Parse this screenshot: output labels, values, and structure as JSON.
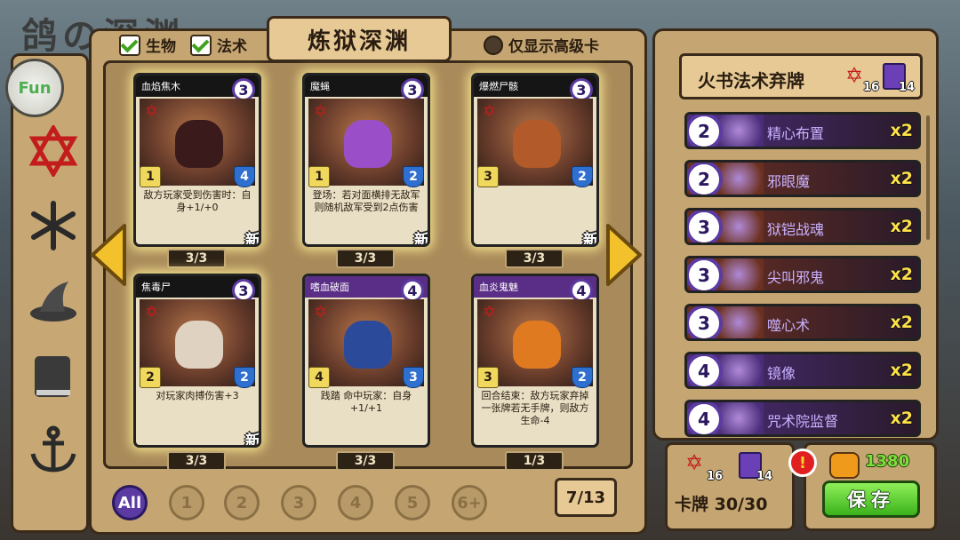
{
  "background": {
    "title": "鸽の深渊"
  },
  "logo": {
    "text": "Fun"
  },
  "filters": {
    "creature_label": "生物",
    "spell_label": "法术",
    "advanced_only_label": "仅显示高级卡"
  },
  "collection": {
    "title": "炼狱深渊",
    "cards": [
      {
        "name": "血焰焦木",
        "cost": "3",
        "attack": "1",
        "health": "4",
        "desc": "敌方玩家受到伤害时：自身+1/+0",
        "new": "新",
        "count": "3/3",
        "rarity": "common",
        "art_color": "#3a1a1a"
      },
      {
        "name": "魔蝇",
        "cost": "3",
        "attack": "1",
        "health": "2",
        "desc": "登场：若对面横排无敌军则随机敌军受到2点伤害",
        "new": "新",
        "count": "3/3",
        "rarity": "common",
        "art_color": "#9a4fc8"
      },
      {
        "name": "爆燃尸骸",
        "cost": "3",
        "attack": "3",
        "health": "2",
        "desc": "",
        "new": "新",
        "count": "3/3",
        "rarity": "common",
        "art_color": "#b25a2a"
      },
      {
        "name": "焦毒尸",
        "cost": "3",
        "attack": "2",
        "health": "2",
        "desc": "对玩家肉搏伤害+3",
        "new": "新",
        "count": "3/3",
        "rarity": "common",
        "art_color": "#e0d2c0"
      },
      {
        "name": "嗜血破面",
        "cost": "4",
        "attack": "4",
        "health": "3",
        "desc": "践踏 命中玩家：自身+1/+1",
        "new": "",
        "count": "3/3",
        "rarity": "epic",
        "art_color": "#2c4a9a"
      },
      {
        "name": "血炎鬼魅",
        "cost": "4",
        "attack": "3",
        "health": "2",
        "desc": "回合结束：敌方玩家弃掉一张牌若无手牌，则敌方生命-4",
        "new": "",
        "count": "1/3",
        "rarity": "epic",
        "art_color": "#e07a20"
      }
    ]
  },
  "pagination": {
    "buttons": [
      "All",
      "1",
      "2",
      "3",
      "4",
      "5",
      "6+"
    ],
    "active": "All",
    "page_count": "7/13"
  },
  "deck": {
    "name": "火书法术弃牌",
    "hex_count": "16",
    "book_count": "14",
    "entries": [
      {
        "cost": "2",
        "name": "精心布置",
        "mult": "x2",
        "color": "#4a2d7a"
      },
      {
        "cost": "2",
        "name": "邪眼魔",
        "mult": "x2",
        "color": "#6b3020"
      },
      {
        "cost": "3",
        "name": "狱铠战魂",
        "mult": "x2",
        "color": "#6b3020"
      },
      {
        "cost": "3",
        "name": "尖叫邪鬼",
        "mult": "x2",
        "color": "#6b3020"
      },
      {
        "cost": "3",
        "name": "噬心术",
        "mult": "x2",
        "color": "#6b3020"
      },
      {
        "cost": "4",
        "name": "镜像",
        "mult": "x2",
        "color": "#4a2d7a"
      },
      {
        "cost": "4",
        "name": "咒术院监督",
        "mult": "x2",
        "color": "#4a2d7a"
      }
    ]
  },
  "deck_stats": {
    "hex_count": "16",
    "book_count": "14",
    "card_total": "卡牌 30/30"
  },
  "resources": {
    "gold": "1380",
    "warning": "!"
  },
  "save_button": "保存",
  "colors": {
    "panel": "#c5a571",
    "border": "#3a2a1a",
    "accent_purple": "#5b3aa1",
    "save_green": "#3ab21a",
    "gold_green": "#7de03a"
  }
}
